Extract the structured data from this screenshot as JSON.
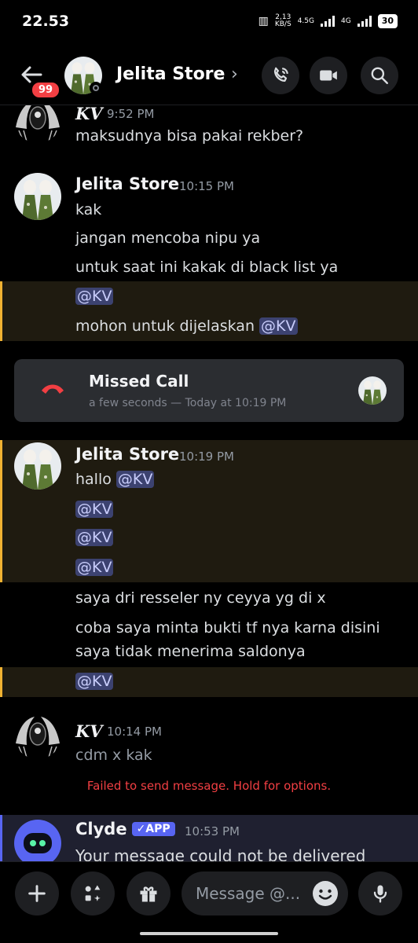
{
  "status_bar": {
    "time": "22.53",
    "net_rate_top": "2,13",
    "net_rate_bottom": "KB/S",
    "net1": "4.5G",
    "net2": "4G",
    "battery": "30"
  },
  "header": {
    "back_badge": "99",
    "channel_name": "Jelita Store",
    "chevron": "›"
  },
  "messages": {
    "kv_top": {
      "author": "KV",
      "time": "9:52 PM",
      "text": "maksudnya bisa pakai rekber?"
    },
    "jelita1": {
      "author": "Jelita Store",
      "time": "10:15 PM",
      "lines": [
        "kak",
        "jangan mencoba nipu ya",
        "untuk saat ini kakak di black list ya"
      ],
      "mention1": "@KV",
      "line_before_mention": "mohon untuk dijelaskan ",
      "mention2": "@KV"
    },
    "missed_call": {
      "title": "Missed Call",
      "subtitle": "a few seconds — Today at 10:19 PM"
    },
    "jelita2": {
      "author": "Jelita Store",
      "time": "10:19 PM",
      "hallo": "hallo ",
      "mentions": [
        "@KV",
        "@KV",
        "@KV",
        "@KV",
        "@KV"
      ],
      "lines": [
        "saya dri resseler ny ceyya yg di x",
        "coba saya minta bukti tf nya karna disini",
        "saya tidak menerima saldonya"
      ]
    },
    "kv_bottom": {
      "author": "KV",
      "time": "10:14 PM",
      "text": "cdm x kak",
      "failed": "Failed to send message. Hold for options."
    },
    "clyde": {
      "author": "Clyde",
      "tag": "✓APP",
      "time": "10:53 PM",
      "text": "Your message could not be delivered"
    }
  },
  "composer": {
    "placeholder": "Message @..."
  },
  "icons": {
    "back": "arrow-left-icon",
    "call": "phone-icon",
    "video": "video-camera-icon",
    "search": "search-icon",
    "add": "plus-icon",
    "apps": "apps-icon",
    "gift": "gift-icon",
    "emoji": "emoji-icon",
    "mic": "microphone-icon",
    "missed": "hangup-phone-icon"
  },
  "colors": {
    "mention_bg": "#3c4270",
    "mention_text": "#c9cdfb",
    "highlight_bar": "#f0b232",
    "error": "#f23f43",
    "blurple": "#5865f2"
  }
}
